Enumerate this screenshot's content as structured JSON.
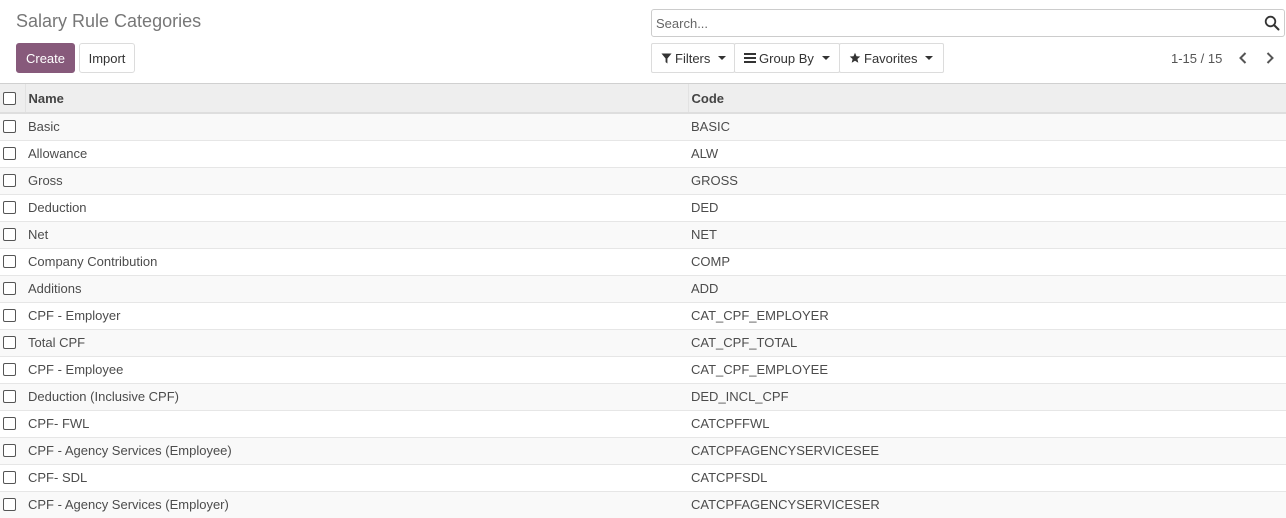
{
  "page": {
    "title": "Salary Rule Categories"
  },
  "buttons": {
    "create": "Create",
    "import": "Import"
  },
  "search": {
    "placeholder": "Search..."
  },
  "filters": {
    "filters": "Filters",
    "group_by": "Group By",
    "favorites": "Favorites"
  },
  "pager": {
    "value": "1-15 / 15"
  },
  "table": {
    "columns": {
      "name": "Name",
      "code": "Code"
    },
    "rows": [
      {
        "name": "Basic",
        "code": "BASIC"
      },
      {
        "name": "Allowance",
        "code": "ALW"
      },
      {
        "name": "Gross",
        "code": "GROSS"
      },
      {
        "name": "Deduction",
        "code": "DED"
      },
      {
        "name": "Net",
        "code": "NET"
      },
      {
        "name": "Company Contribution",
        "code": "COMP"
      },
      {
        "name": "Additions",
        "code": "ADD"
      },
      {
        "name": "CPF - Employer",
        "code": "CAT_CPF_EMPLOYER"
      },
      {
        "name": "Total CPF",
        "code": "CAT_CPF_TOTAL"
      },
      {
        "name": "CPF - Employee",
        "code": "CAT_CPF_EMPLOYEE"
      },
      {
        "name": "Deduction (Inclusive CPF)",
        "code": "DED_INCL_CPF"
      },
      {
        "name": "CPF- FWL",
        "code": "CATCPFFWL"
      },
      {
        "name": "CPF - Agency Services (Employee)",
        "code": "CATCPFAGENCYSERVICESEE"
      },
      {
        "name": "CPF- SDL",
        "code": "CATCPFSDL"
      },
      {
        "name": "CPF - Agency Services (Employer)",
        "code": "CATCPFAGENCYSERVICESER"
      }
    ]
  },
  "colors": {
    "primary": "#875a7b",
    "header_bg": "#eeeeee",
    "row_alt": "#f9f9f9"
  },
  "icons": {
    "search": "search-icon",
    "filters": "filter-icon",
    "group_by": "bars-icon",
    "favorites": "star-icon",
    "prev": "chevron-left-icon",
    "next": "chevron-right-icon"
  }
}
